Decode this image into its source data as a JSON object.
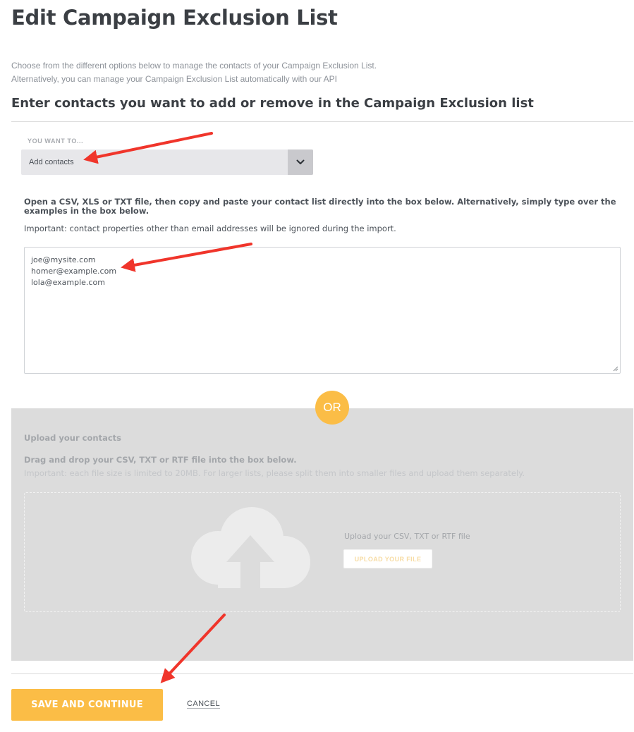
{
  "header": {
    "title": "Edit Campaign Exclusion List",
    "intro_line1": "Choose from the different options below to manage the contacts of your Campaign Exclusion List.",
    "intro_line2": "Alternatively, you can manage your Campaign Exclusion List automatically with our API"
  },
  "section": {
    "heading": "Enter contacts you want to add or remove in the Campaign Exclusion list"
  },
  "action_select": {
    "label": "YOU WANT TO...",
    "value": "Add contacts",
    "toggle_icon": "chevron-down-icon"
  },
  "paste": {
    "instructions": "Open a CSV, XLS or TXT file, then copy and paste your contact list directly into the box below. Alternatively, simply type over the examples in the box below.",
    "important": "Important: contact properties other than email addresses will be ignored during the import.",
    "contacts": [
      "joe@mysite.com",
      "homer@example.com",
      "lola@example.com"
    ]
  },
  "divider_text": "OR",
  "upload": {
    "title": "Upload your contacts",
    "drag_text": "Drag and drop your CSV, TXT or RTF file into the box below.",
    "note": "Important: each file size is limited to 20MB. For larger lists, please split them into smaller files and upload them separately.",
    "dropzone_text": "Upload your CSV, TXT or RTF file",
    "button_label": "UPLOAD YOUR FILE",
    "icon": "cloud-upload-icon"
  },
  "footer": {
    "save_label": "SAVE AND CONTINUE",
    "cancel_label": "CANCEL"
  },
  "colors": {
    "accent": "#fbbd46",
    "annotation_arrow": "#f0352b",
    "upload_panel_bg": "#dcdcdc",
    "select_bg": "#e7e7ea"
  }
}
